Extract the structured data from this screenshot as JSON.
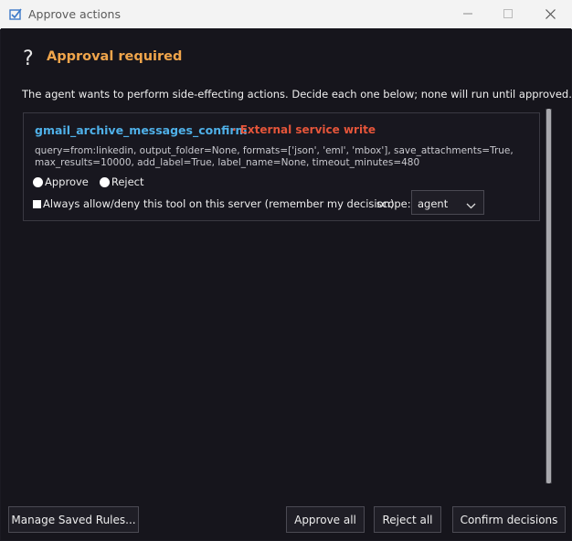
{
  "window": {
    "title": "Approve actions",
    "icon": "app-icon",
    "controls": [
      "minimize-icon",
      "maximize-icon",
      "close-icon"
    ]
  },
  "header": {
    "help_glyph": "?",
    "title": "Approval required",
    "title_color": "#f0a54b"
  },
  "intro_text": "The agent wants to perform side-effecting actions. Decide each one below; none will run until approved.",
  "action": {
    "tool_name": "gmail_archive_messages_confirm",
    "tool_name_color": "#4fb0e8",
    "risk_label": "· External service write",
    "risk_color": "#e5553a",
    "args_line1": "query=from:linkedin, output_folder=None, formats=['json', 'eml', 'mbox'], save_attachments=True,",
    "args_line2": "max_results=10000, add_label=True, label_name=None, timeout_minutes=480",
    "approve_label": "Approve",
    "reject_label": "Reject",
    "remember_label": "Always allow/deny this tool on this server (remember my decision)",
    "scope_label": "scope:",
    "scope_value": "agent"
  },
  "footer": {
    "manage_label": "Manage Saved Rules...",
    "approve_all_label": "Approve all",
    "reject_all_label": "Reject all",
    "confirm_label": "Confirm decisions"
  }
}
